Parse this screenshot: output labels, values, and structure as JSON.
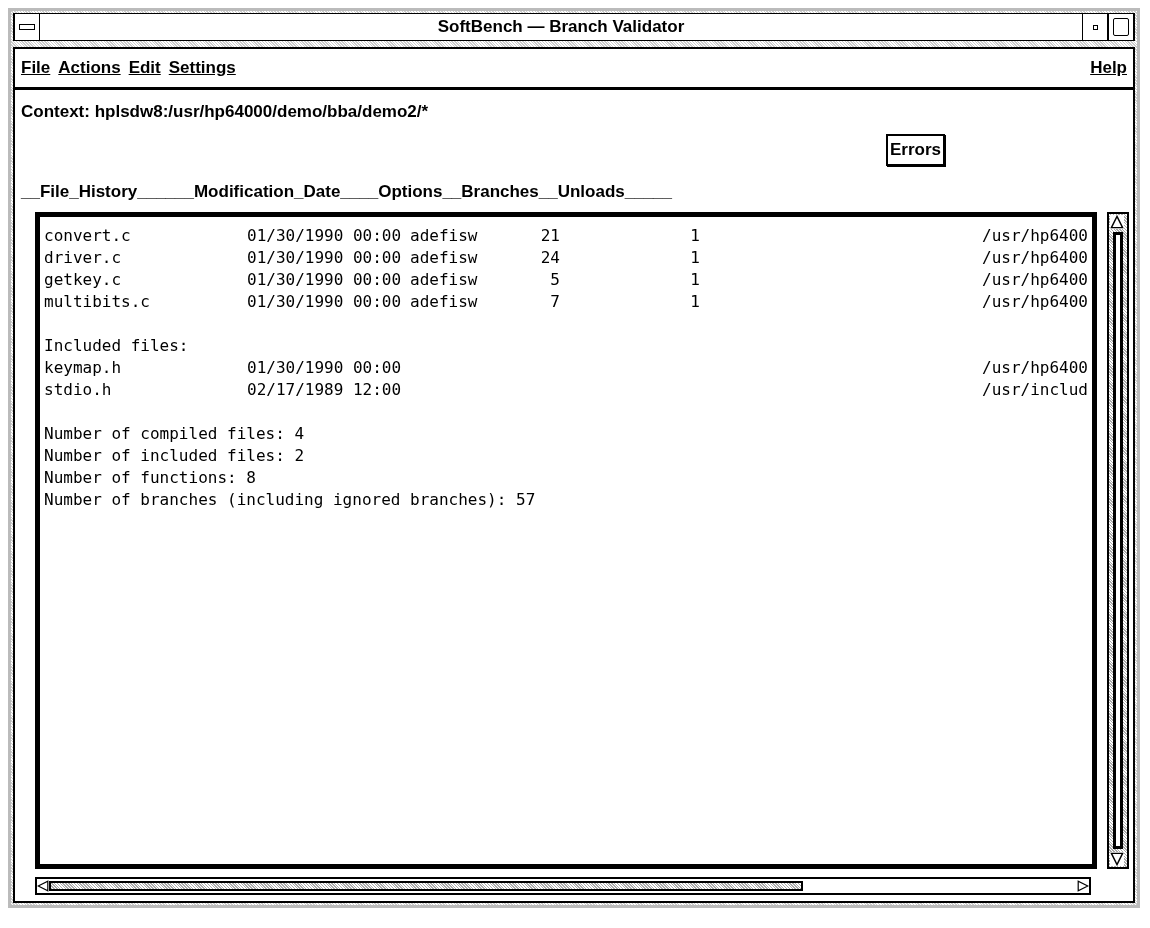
{
  "window": {
    "title": "SoftBench — Branch Validator"
  },
  "menu": {
    "left": [
      "File",
      "Actions",
      "Edit",
      "Settings"
    ],
    "right": [
      "Help"
    ]
  },
  "context": "Context: hplsdw8:/usr/hp64000/demo/bba/demo2/*",
  "errors_button": "Errors",
  "header": "__File_History______Modification_Date____Options__Branches__Unloads_____",
  "compiled_files": [
    {
      "name": "convert.c",
      "date": "01/30/1990 00:00",
      "options": "adefisw",
      "branches": "21",
      "unloads": "1",
      "path": "/usr/hp6400"
    },
    {
      "name": "driver.c",
      "date": "01/30/1990 00:00",
      "options": "adefisw",
      "branches": "24",
      "unloads": "1",
      "path": "/usr/hp6400"
    },
    {
      "name": "getkey.c",
      "date": "01/30/1990 00:00",
      "options": "adefisw",
      "branches": "5",
      "unloads": "1",
      "path": "/usr/hp6400"
    },
    {
      "name": "multibits.c",
      "date": "01/30/1990 00:00",
      "options": "adefisw",
      "branches": "7",
      "unloads": "1",
      "path": "/usr/hp6400"
    }
  ],
  "included_heading": "Included files:",
  "included_files": [
    {
      "name": "keymap.h",
      "date": "01/30/1990 00:00",
      "path": "/usr/hp6400"
    },
    {
      "name": "stdio.h",
      "date": "02/17/1989 12:00",
      "path": "/usr/includ"
    }
  ],
  "summary": [
    "Number of compiled files: 4",
    "Number of included files: 2",
    "Number of functions: 8",
    "Number of branches (including ignored branches): 57"
  ]
}
